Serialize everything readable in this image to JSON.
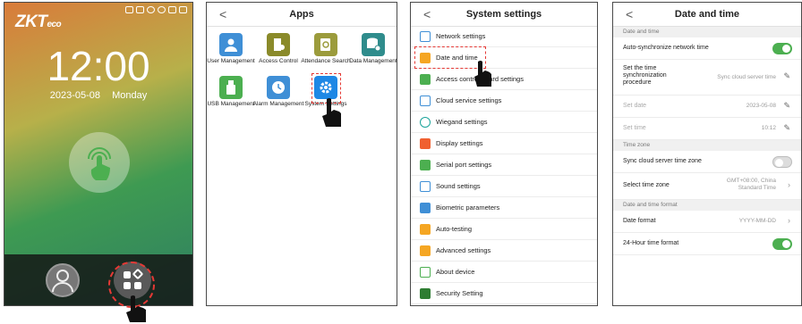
{
  "panel1": {
    "logo": "ZKT",
    "logo_suffix": "eco",
    "time": "12:00",
    "date": "2023-05-08",
    "weekday": "Monday",
    "icons": [
      "fingerprint-touch-icon",
      "user-icon",
      "menu-grid-icon"
    ]
  },
  "panel2": {
    "title": "Apps",
    "back": "<",
    "apps": [
      {
        "label": "User Management",
        "color": "#3f8fd6"
      },
      {
        "label": "Access Control",
        "color": "#8a8a2a"
      },
      {
        "label": "Attendance Search",
        "color": "#9b9b3c"
      },
      {
        "label": "Data Management",
        "color": "#2f8c8c"
      },
      {
        "label": "USB Management",
        "color": "#4caf50"
      },
      {
        "label": "Alarm Management",
        "color": "#3f8fd6"
      },
      {
        "label": "System Settings",
        "color": "#1e88e5"
      }
    ]
  },
  "panel3": {
    "title": "System settings",
    "back": "<",
    "items": [
      {
        "label": "Network settings",
        "color": "#3f8fd6"
      },
      {
        "label": "Date and time",
        "color": "#f5a623"
      },
      {
        "label": "Access control board settings",
        "color": "#4caf50"
      },
      {
        "label": "Cloud service settings",
        "color": "#3f8fd6"
      },
      {
        "label": "Wiegand settings",
        "color": "#1aa39a"
      },
      {
        "label": "Display settings",
        "color": "#f06030"
      },
      {
        "label": "Serial port settings",
        "color": "#4caf50"
      },
      {
        "label": "Sound settings",
        "color": "#3f8fd6"
      },
      {
        "label": "Biometric parameters",
        "color": "#3f8fd6"
      },
      {
        "label": "Auto-testing",
        "color": "#f5a623"
      },
      {
        "label": "Advanced settings",
        "color": "#f5a623"
      },
      {
        "label": "About device",
        "color": "#4caf50"
      },
      {
        "label": "Security Setting",
        "color": "#2e7d32"
      }
    ]
  },
  "panel4": {
    "title": "Date and time",
    "back": "<",
    "sec1": "Date and time",
    "auto_sync": "Auto-synchronize network time",
    "sync_proc_label": "Set the time synchronization procedure",
    "sync_proc_value": "Sync cloud server time",
    "set_date": "Set date",
    "set_date_value": "2023-05-08",
    "set_time": "Set time",
    "set_time_value": "10:12",
    "sec2": "Time zone",
    "sync_tz": "Sync cloud server time zone",
    "select_tz": "Select time zone",
    "select_tz_value": "GMT+08:00, China Standard Time",
    "sec3": "Date and time format",
    "date_format": "Date format",
    "date_format_value": "YYYY-MM-DD",
    "hour24": "24-Hour time format",
    "accent": "#4caf50"
  }
}
